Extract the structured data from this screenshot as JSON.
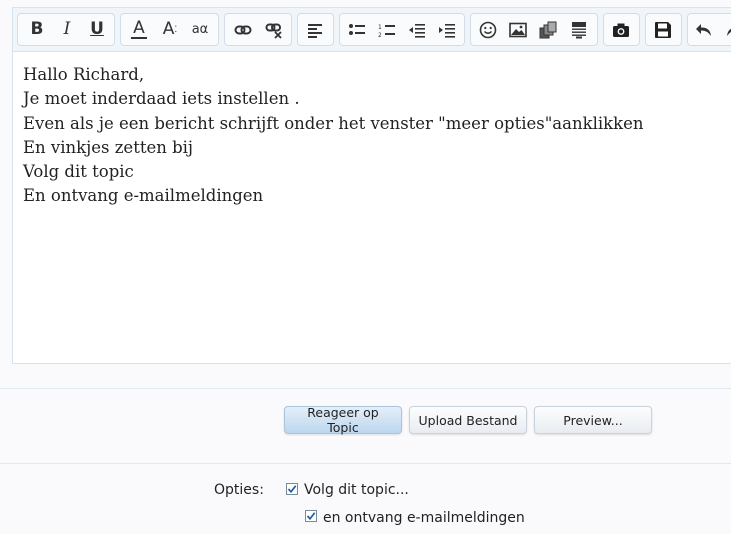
{
  "editor": {
    "toolbar": {
      "bold": "B",
      "italic": "I",
      "underline": "U",
      "font_color": "A",
      "font_size": "A",
      "smallcaps": "aα"
    },
    "lines": [
      "Hallo Richard,",
      "Je moet inderdaad iets instellen .",
      "Even als je een bericht schrijft onder het venster \"meer opties\"aanklikken",
      "En vinkjes zetten bij",
      "Volg dit topic",
      "En ontvang e-mailmeldingen"
    ]
  },
  "actions": {
    "reply_label": "Reageer op Topic",
    "upload_label": "Upload Bestand",
    "preview_label": "Preview..."
  },
  "options": {
    "label": "Opties:",
    "follow_label": "Volg dit topic...",
    "follow_checked": true,
    "email_label": "en ontvang e-mailmeldingen",
    "email_checked": true
  },
  "colors": {
    "accent": "#bcd7ee",
    "check": "#1f5fa8"
  }
}
